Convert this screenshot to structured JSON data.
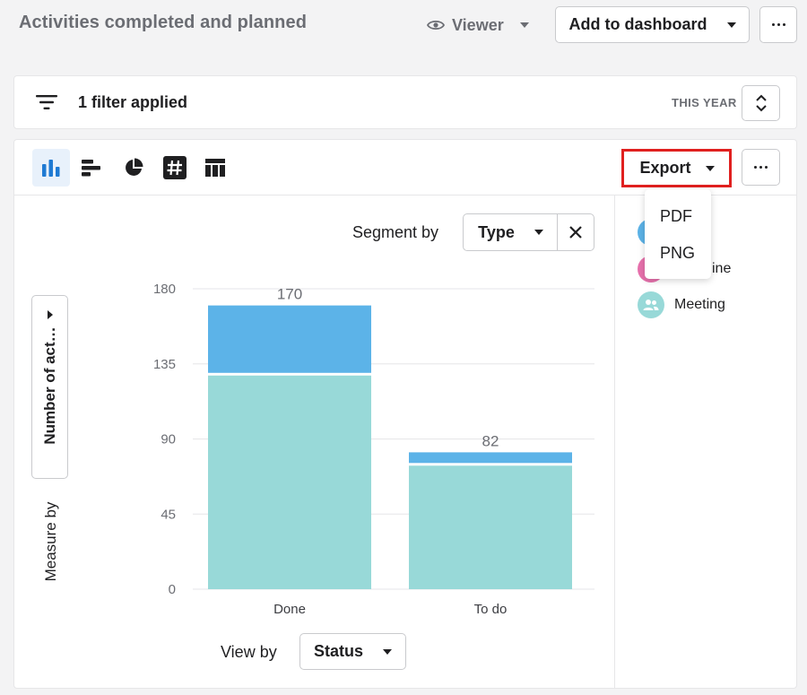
{
  "header": {
    "title": "Activities completed and planned",
    "viewer_label": "Viewer",
    "add_to_dashboard": "Add to dashboard"
  },
  "filter": {
    "label": "1 filter applied",
    "period": "THIS YEAR"
  },
  "toolbar": {
    "chart_types": [
      "vertical-bar-chart-icon",
      "horizontal-bar-chart-icon",
      "pie-chart-icon",
      "number-hash-icon",
      "table-icon"
    ],
    "active_type": "vertical-bar-chart-icon",
    "export_label": "Export"
  },
  "export_menu": {
    "items": [
      "PDF",
      "PNG"
    ]
  },
  "segment": {
    "label": "Segment by",
    "value": "Type"
  },
  "measure": {
    "value": "Number of act…",
    "label": "Measure by"
  },
  "view_by": {
    "label": "View by",
    "value": "Status"
  },
  "legend": {
    "items": [
      {
        "label": "",
        "color": "#5cb3e8"
      },
      {
        "label": "ine",
        "color": "#e871ad"
      },
      {
        "label": "Meeting",
        "color": "#98d9d8"
      }
    ]
  },
  "colors": {
    "series_top": "#5cb3e8",
    "series_bottom": "#98d9d8",
    "accent_highlight": "#e0201f",
    "active_tab_bg": "#e8f1fb"
  },
  "chart_data": {
    "type": "bar",
    "stacked": true,
    "categories": [
      "Done",
      "To do"
    ],
    "series": [
      {
        "values": [
          128,
          74
        ],
        "color": "#98d9d8"
      },
      {
        "values": [
          42,
          8
        ],
        "color": "#5cb3e8"
      }
    ],
    "totals": [
      "170",
      "82"
    ],
    "yticks": [
      "0",
      "45",
      "90",
      "135",
      "180"
    ],
    "ylim": [
      0,
      180
    ],
    "grid": true
  }
}
